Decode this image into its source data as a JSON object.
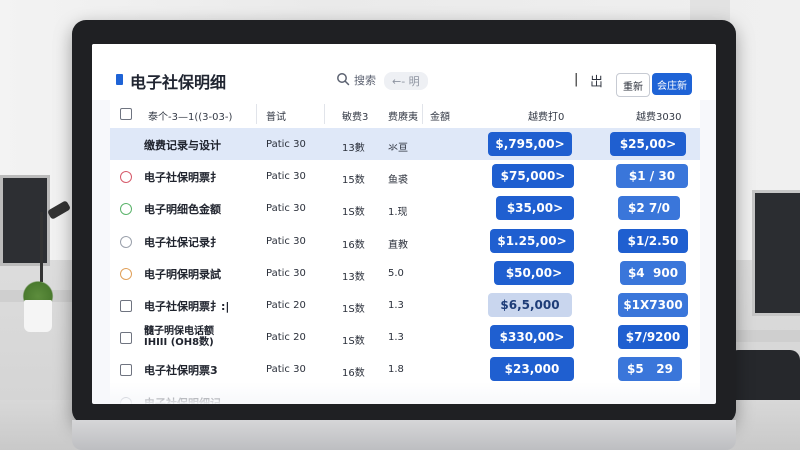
{
  "app": {
    "title": "电子社保明细",
    "search_label": "搜索",
    "nav_back": "←- 明",
    "cursor": "|",
    "header_text_btn": "岀",
    "btn_outline": "重新",
    "btn_primary": "会庄新"
  },
  "table": {
    "headers": {
      "select_all": "",
      "name": "泰个-3—1((3-03-)",
      "plan": "普试",
      "count": "敏费3",
      "fee": "费赓夷",
      "col5": "金額",
      "total": "越费打0",
      "amount": "越费3030"
    },
    "rows": [
      {
        "name": "缴费记录与设计",
        "plan": "Patic 30",
        "count": "13數",
        "fee": "氺亘",
        "total": "$,795,00>",
        "amount": "$25,00>",
        "marker": "none",
        "highlight": true
      },
      {
        "name": "电子社保明票扌",
        "plan": "Patic 30",
        "count": "15数",
        "fee": "鱼裘",
        "total": "$75,000>",
        "amount": "$1 / 30",
        "marker": "red",
        "highlight": false
      },
      {
        "name": "电子明细色金额",
        "plan": "Patic 30",
        "count": "1S数",
        "fee": "1.现",
        "total": "$35,00>",
        "amount": "$2 7/0",
        "marker": "green",
        "highlight": false
      },
      {
        "name": "电子社保记录扌",
        "plan": "Patic 30",
        "count": "16数",
        "fee": "直教",
        "total": "$1.25,00>",
        "amount": "$1/2.50",
        "marker": "grey",
        "highlight": false
      },
      {
        "name": "电子明保明录試",
        "plan": "Patic 30",
        "count": "13数",
        "fee": "5.0",
        "total": "$50,00>",
        "amount": "$4  900",
        "marker": "orange",
        "highlight": false
      },
      {
        "name": "电子社保明票扌:|",
        "plan": "Patic 20",
        "count": "1S数",
        "fee": "1.3",
        "total": "$6,5,000",
        "amount": "$1X7300",
        "marker": "checkbox",
        "highlight": false
      },
      {
        "name": "髓子明保电话额\nIHIII (OH8数)",
        "plan": "Patic 20",
        "count": "1S数",
        "fee": "1.3",
        "total": "$330,00>",
        "amount": "$7/9200",
        "marker": "checkbox",
        "highlight": false
      },
      {
        "name": "电子社保明票3",
        "plan": "Patic 30",
        "count": "16数",
        "fee": "1.8",
        "total": "$23,000",
        "amount": "$5   29",
        "marker": "checkbox",
        "highlight": false
      },
      {
        "name": "电子社保明细记",
        "plan": "",
        "count": "",
        "fee": "",
        "total": "",
        "amount": "",
        "marker": "grey",
        "highlight": false
      }
    ]
  },
  "colors": {
    "accent": "#1e63d6",
    "pill": "#1f5fd0",
    "row_highlight": "#dfe8f8"
  },
  "icons": {
    "search": "search-icon",
    "brand": "brand-mark-icon"
  }
}
